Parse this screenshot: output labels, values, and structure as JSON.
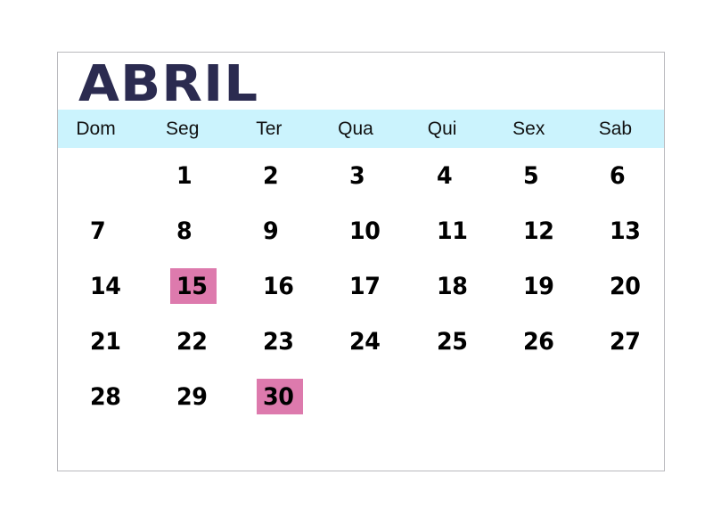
{
  "calendar": {
    "title": "ABRIL",
    "weekdays": [
      {
        "label": "Dom"
      },
      {
        "label": "Seg"
      },
      {
        "label": "Ter"
      },
      {
        "label": "Qua"
      },
      {
        "label": "Qui"
      },
      {
        "label": "Sex"
      },
      {
        "label": "Sab"
      }
    ],
    "colors": {
      "title": "#2b2b50",
      "weekday_band": "#cbf3fd",
      "highlight": "#dd7aad",
      "day_text": "#000000",
      "card_border": "#b9b9bd",
      "background": "#ffffff"
    },
    "weeks": [
      [
        {
          "day": "",
          "highlighted": false
        },
        {
          "day": "1",
          "highlighted": false
        },
        {
          "day": "2",
          "highlighted": false
        },
        {
          "day": "3",
          "highlighted": false
        },
        {
          "day": "4",
          "highlighted": false
        },
        {
          "day": "5",
          "highlighted": false
        },
        {
          "day": "6",
          "highlighted": false
        }
      ],
      [
        {
          "day": "7",
          "highlighted": false
        },
        {
          "day": "8",
          "highlighted": false
        },
        {
          "day": "9",
          "highlighted": false
        },
        {
          "day": "10",
          "highlighted": false
        },
        {
          "day": "11",
          "highlighted": false
        },
        {
          "day": "12",
          "highlighted": false
        },
        {
          "day": "13",
          "highlighted": false
        }
      ],
      [
        {
          "day": "14",
          "highlighted": false
        },
        {
          "day": "15",
          "highlighted": true
        },
        {
          "day": "16",
          "highlighted": false
        },
        {
          "day": "17",
          "highlighted": false
        },
        {
          "day": "18",
          "highlighted": false
        },
        {
          "day": "19",
          "highlighted": false
        },
        {
          "day": "20",
          "highlighted": false
        }
      ],
      [
        {
          "day": "21",
          "highlighted": false
        },
        {
          "day": "22",
          "highlighted": false
        },
        {
          "day": "23",
          "highlighted": false
        },
        {
          "day": "24",
          "highlighted": false
        },
        {
          "day": "25",
          "highlighted": false
        },
        {
          "day": "26",
          "highlighted": false
        },
        {
          "day": "27",
          "highlighted": false
        }
      ],
      [
        {
          "day": "28",
          "highlighted": false
        },
        {
          "day": "29",
          "highlighted": false
        },
        {
          "day": "30",
          "highlighted": true
        },
        {
          "day": "",
          "highlighted": false
        },
        {
          "day": "",
          "highlighted": false
        },
        {
          "day": "",
          "highlighted": false
        },
        {
          "day": "",
          "highlighted": false
        }
      ]
    ]
  }
}
